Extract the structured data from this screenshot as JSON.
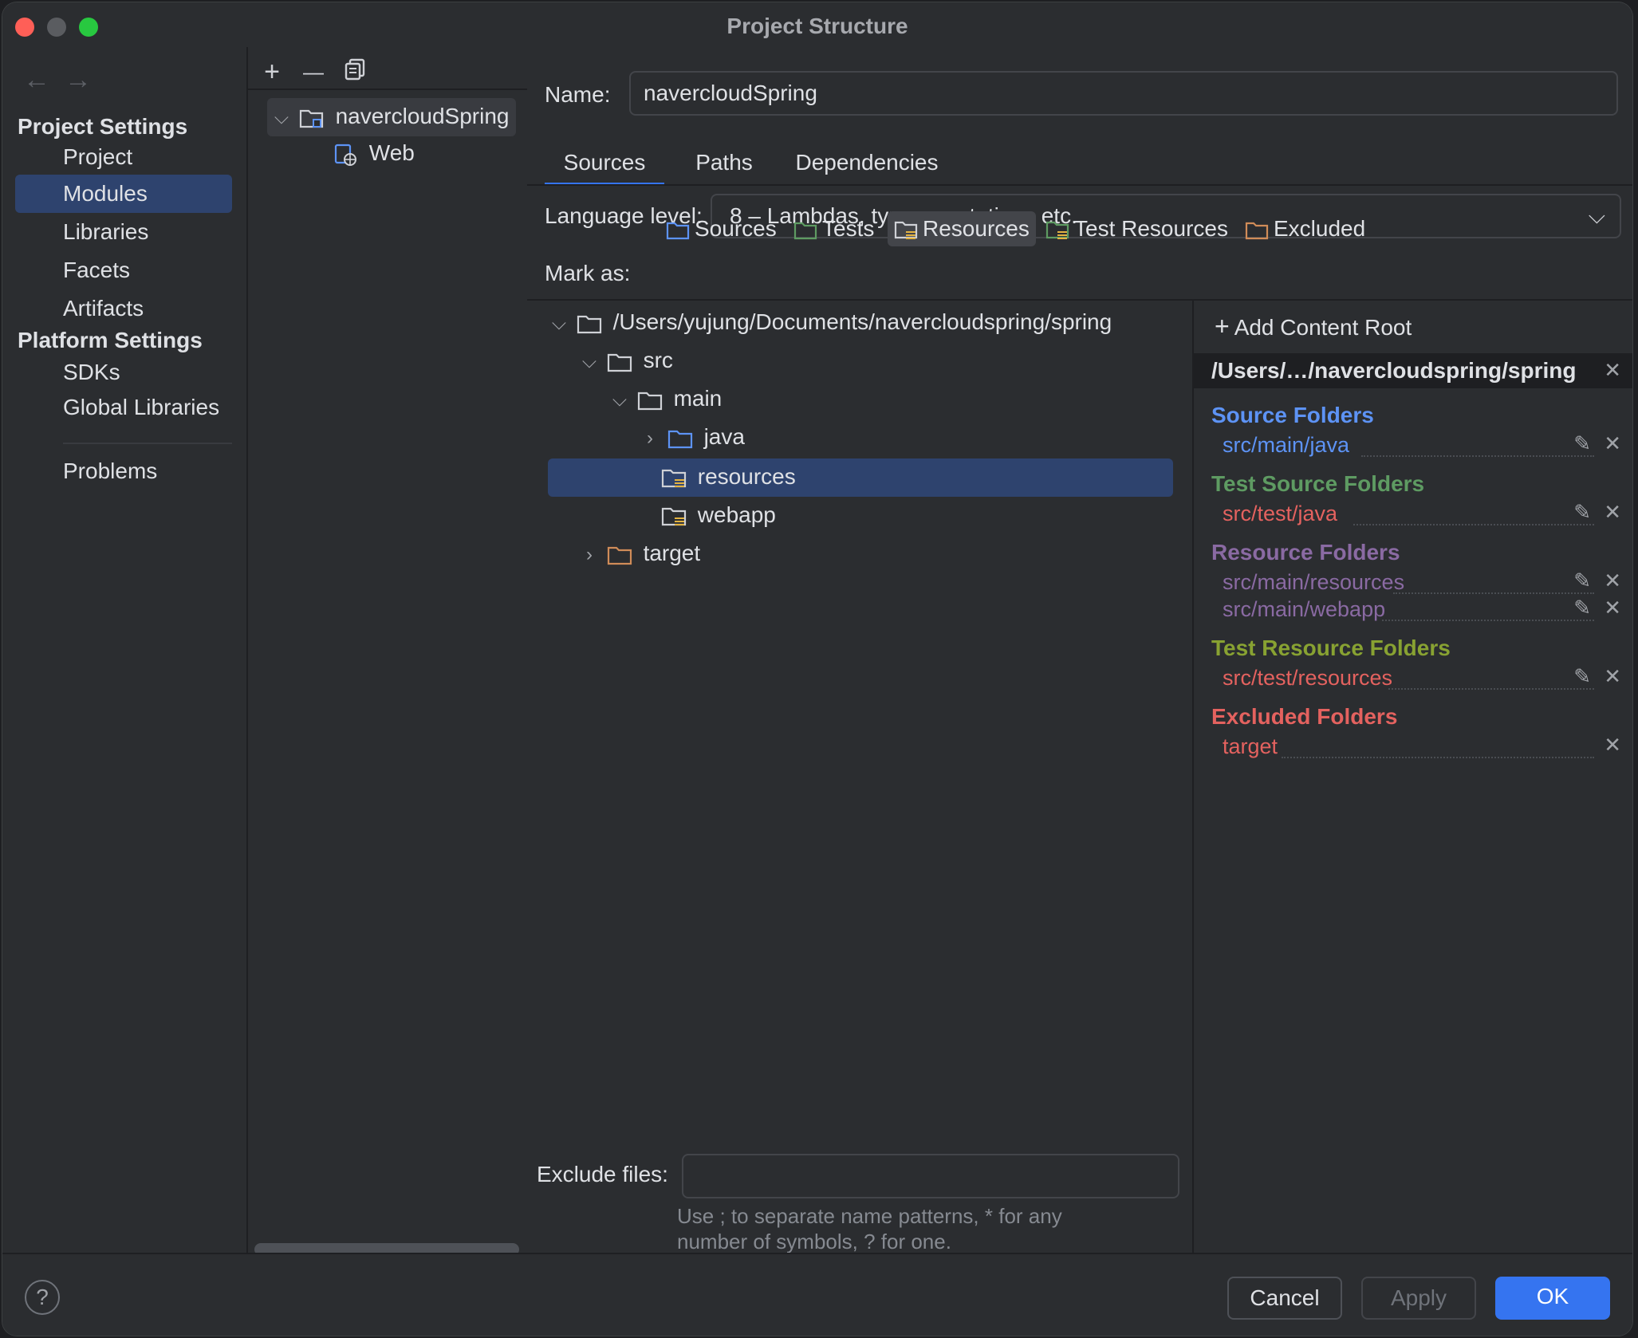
{
  "window": {
    "title": "Project Structure",
    "traffic_colors": {
      "close": "#ff5f57",
      "minimize": "#5a5c60",
      "zoom": "#28c840"
    }
  },
  "sidebar": {
    "back_icon": "arrow-left-icon",
    "forward_icon": "arrow-right-icon",
    "project_settings_heading": "Project Settings",
    "project_items": [
      "Project",
      "Modules",
      "Libraries",
      "Facets",
      "Artifacts"
    ],
    "selected": "Modules",
    "platform_settings_heading": "Platform Settings",
    "platform_items": [
      "SDKs",
      "Global Libraries"
    ],
    "problems": "Problems"
  },
  "modules": {
    "toolbar": {
      "add": "+",
      "remove": "—",
      "copy_icon": "copy-icon"
    },
    "root": "navercloudSpring",
    "child": "Web"
  },
  "main": {
    "name_label": "Name:",
    "name_value": "navercloudSpring",
    "tabs": [
      "Sources",
      "Paths",
      "Dependencies"
    ],
    "active_tab": "Sources",
    "language_label": "Language level:",
    "language_value": "8 – Lambdas, type annotations etc.",
    "mark_label": "Mark as:",
    "mark_buttons": [
      "Sources",
      "Tests",
      "Resources",
      "Test Resources",
      "Excluded"
    ],
    "mark_selected": "Resources",
    "exclude_label": "Exclude files:",
    "exclude_value": "",
    "exclude_hint": "Use ; to separate name patterns, * for any number of symbols, ? for one."
  },
  "tree": {
    "root": "/Users/yujung/Documents/navercloudspring/spring",
    "src": "src",
    "main": "main",
    "java": "java",
    "resources": "resources",
    "webapp": "webapp",
    "target": "target",
    "selected": "resources"
  },
  "content_roots": {
    "add_label": "Add Content Root",
    "root_path": "/Users/…/navercloudspring/spring",
    "groups": {
      "source": {
        "title": "Source Folders",
        "color": "#5d93f5",
        "paths": [
          "src/main/java"
        ]
      },
      "test_source": {
        "title": "Test Source Folders",
        "color": "#5e9b62",
        "paths": [
          "src/test/java"
        ]
      },
      "resource": {
        "title": "Resource Folders",
        "color": "#8a6aa3",
        "paths": [
          "src/main/resources",
          "src/main/webapp"
        ]
      },
      "test_resource": {
        "title": "Test Resource Folders",
        "color": "#88a232",
        "paths": [
          "src/test/resources"
        ]
      },
      "excluded": {
        "title": "Excluded Folders",
        "color": "#e4625f",
        "paths": [
          "target"
        ]
      }
    },
    "path_colors": {
      "source": "#5d93f5",
      "test_source": "#e4625f",
      "resource": "#8a6aa3",
      "test_resource": "#e4625f",
      "excluded": "#e4625f"
    }
  },
  "buttons": {
    "help": "?",
    "cancel": "Cancel",
    "apply": "Apply",
    "ok": "OK",
    "accent": "#3574f0"
  }
}
